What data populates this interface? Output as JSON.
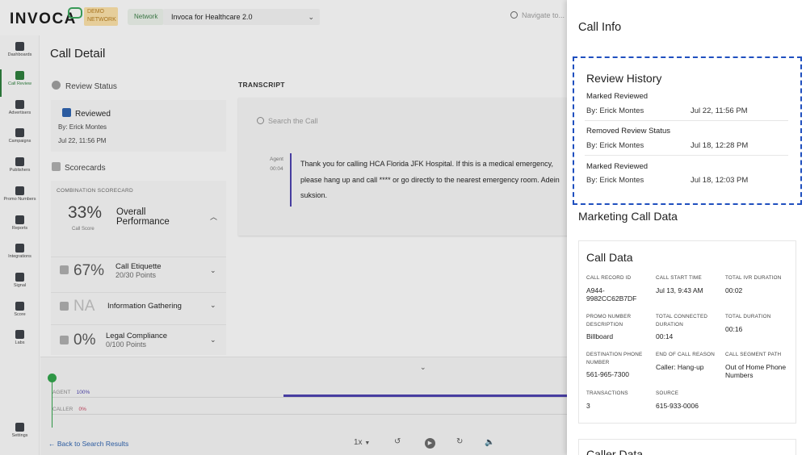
{
  "header": {
    "logo": "INVOCA",
    "demo_badge_line1": "DEMO",
    "demo_badge_line2": "NETWORK",
    "network_label": "Network",
    "network_value": "Invoca for Healthcare 2.0",
    "search_placeholder": "Navigate to..."
  },
  "sidebar": {
    "items": [
      {
        "label": "Dashboards",
        "icon": "grid-icon"
      },
      {
        "label": "Call Review",
        "icon": "call-review-icon"
      },
      {
        "label": "Advertisers",
        "icon": "advertisers-icon"
      },
      {
        "label": "Campaigns",
        "icon": "phone-icon"
      },
      {
        "label": "Publishers",
        "icon": "people-icon"
      },
      {
        "label": "Promo Numbers",
        "icon": "keypad-icon"
      },
      {
        "label": "Reports",
        "icon": "bar-chart-icon"
      },
      {
        "label": "Integrations",
        "icon": "network-icon"
      },
      {
        "label": "Signal",
        "icon": "compass-icon"
      },
      {
        "label": "Score",
        "icon": "checkbox-icon"
      },
      {
        "label": "Labs",
        "icon": "flask-icon"
      }
    ],
    "settings": "Settings",
    "active": "Call Review"
  },
  "main": {
    "title": "Call Detail",
    "review_status": "Review Status",
    "reviewed": "Reviewed",
    "reviewed_by": "By: Erick Montes",
    "reviewed_date": "Jul 22, 11:56 PM",
    "scorecards": "Scorecards",
    "combination_label": "COMBINATION SCORECARD",
    "overall_pct": "33%",
    "call_score": "Call Score",
    "overall_line1": "Overall",
    "overall_line2": "Performance",
    "rows": [
      {
        "pct": "67%",
        "name": "Call Etiquette",
        "sub": "20/30 Points"
      },
      {
        "pct": "NA",
        "name": "Information Gathering",
        "sub": ""
      },
      {
        "pct": "0%",
        "name": "Legal Compliance",
        "sub": "0/100 Points"
      }
    ]
  },
  "transcript": {
    "title": "TRANSCRIPT",
    "search_placeholder": "Search the Call",
    "speaker": "Agent",
    "time": "00:04",
    "line1": "Thank you for calling HCA Florida JFK Hospital. If this is a medical emergency,",
    "line2": "please hang up and call **** or go directly to the nearest emergency room. Adein",
    "line3": "suksion."
  },
  "timeline": {
    "agent_label": "AGENT",
    "agent_pct": "100%",
    "caller_label": "CALLER",
    "caller_pct": "0%",
    "back_link": "Back to Search Results",
    "speed": "1x"
  },
  "drawer": {
    "title": "Call Info",
    "review_history": {
      "title": "Review History",
      "entries": [
        {
          "action": "Marked Reviewed",
          "by": "By: Erick Montes",
          "date": "Jul 22, 11:56 PM"
        },
        {
          "action": "Removed Review Status",
          "by": "By: Erick Montes",
          "date": "Jul 18, 12:28 PM"
        },
        {
          "action": "Marked Reviewed",
          "by": "By: Erick Montes",
          "date": "Jul 18, 12:03 PM"
        }
      ]
    },
    "marketing_title": "Marketing Call Data",
    "call_data": {
      "title": "Call Data",
      "fields": [
        {
          "label": "CALL RECORD ID",
          "value": "A944-9982CC62B7DF"
        },
        {
          "label": "CALL START TIME",
          "value": "Jul 13, 9:43 AM"
        },
        {
          "label": "TOTAL IVR DURATION",
          "value": "00:02"
        },
        {
          "label": "PROMO NUMBER DESCRIPTION",
          "value": "Billboard"
        },
        {
          "label": "TOTAL CONNECTED DURATION",
          "value": "00:14"
        },
        {
          "label": "TOTAL DURATION",
          "value": "00:16"
        },
        {
          "label": "DESTINATION PHONE NUMBER",
          "value": "561-965-7300"
        },
        {
          "label": "END OF CALL REASON",
          "value": "Caller: Hang-up"
        },
        {
          "label": "CALL SEGMENT PATH",
          "value": "Out of Home Phone Numbers"
        },
        {
          "label": "TRANSACTIONS",
          "value": "3"
        },
        {
          "label": "SOURCE",
          "value": "615-933-0006"
        }
      ]
    },
    "caller_data_title": "Caller Data"
  },
  "colors": {
    "accent_green": "#2b7a3a",
    "agent_purple": "#4a3fa8",
    "link_blue": "#2c5fa8",
    "highlight_dash": "#1f4fbf"
  }
}
